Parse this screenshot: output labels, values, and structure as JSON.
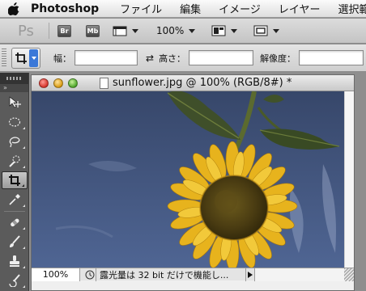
{
  "menubar": {
    "app_name": "Photoshop",
    "items": [
      "ファイル",
      "編集",
      "イメージ",
      "レイヤー",
      "選択範"
    ]
  },
  "appbar": {
    "logo": "Ps",
    "bridge_label": "Br",
    "minibridge_label": "Mb",
    "zoom": "100%"
  },
  "options": {
    "width_label": "幅：",
    "width_value": "",
    "height_label": "高さ：",
    "height_value": "",
    "resolution_label": "解像度：",
    "resolution_value": ""
  },
  "tools": [
    "move",
    "marquee",
    "lasso",
    "quick-selection",
    "crop",
    "eyedropper",
    "spot-healing",
    "brush",
    "clone-stamp",
    "history-brush"
  ],
  "document": {
    "title": "sunflower.jpg @ 100% (RGB/8#) *",
    "zoom": "100%",
    "status": "露光量は 32 bit だけで機能し..."
  },
  "colors": {
    "sky_top": "#3a4a6e",
    "sky_bottom": "#4c6190",
    "petal": "#e8b51e",
    "leaf": "#3e4e2e",
    "panel": "#5b5b5b"
  }
}
